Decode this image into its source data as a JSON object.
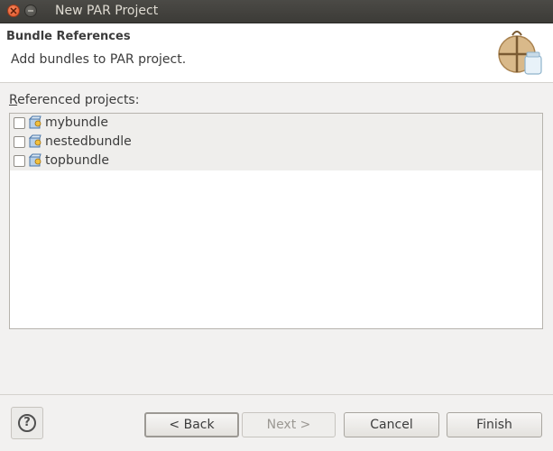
{
  "window": {
    "title": "New PAR Project"
  },
  "header": {
    "title": "Bundle References",
    "description": "Add bundles to PAR project."
  },
  "section": {
    "label_first": "R",
    "label_rest": "eferenced projects:"
  },
  "projects": [
    {
      "name": "mybundle",
      "checked": false
    },
    {
      "name": "nestedbundle",
      "checked": false
    },
    {
      "name": "topbundle",
      "checked": false
    }
  ],
  "buttons": {
    "help": "?",
    "back": "< Back",
    "next": "Next >",
    "cancel": "Cancel",
    "finish": "Finish"
  },
  "icons": {
    "close": "close-icon",
    "minimize": "minimize-icon",
    "wizard": "par-bundle-wizard-icon",
    "project": "bundle-project-icon",
    "help": "help-icon"
  },
  "colors": {
    "titlebar": "#3c3b37",
    "close_button": "#e0542a",
    "background": "#f2f1f0",
    "header_background": "#ffffff"
  }
}
